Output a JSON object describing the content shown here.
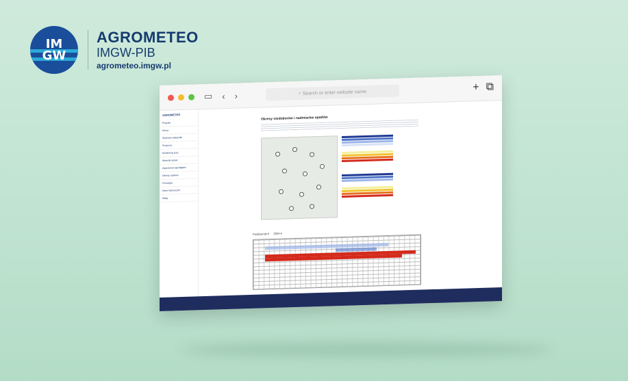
{
  "brand": {
    "logo_line1": "IM",
    "logo_line2": "GW",
    "title": "AGROMETEO",
    "subtitle": "IMGW-PIB",
    "url": "agrometeo.imgw.pl"
  },
  "browser": {
    "address_placeholder": "Search or enter website name",
    "back_icon": "chevron-left-icon",
    "forward_icon": "chevron-right-icon",
    "new_tab": "+",
    "colors": {
      "close": "#ee5a52",
      "minimize": "#f6bc2f",
      "zoom": "#5fc34a"
    }
  },
  "sidebar": {
    "app": "AGROMETEO",
    "items": [
      "Pogoda",
      "Mrozy",
      "Wybrane wskaźniki",
      "Prognozy",
      "Monitoring susz",
      "Warunki upraw",
      "Zagrożenia agrofagami",
      "Okresy opadów",
      "Fenologia",
      "Dane historyczne",
      "Mapy"
    ]
  },
  "content": {
    "heading": "Okresy niedoborów i nadmiarów opadów",
    "month": "Październik",
    "year": "2024"
  }
}
